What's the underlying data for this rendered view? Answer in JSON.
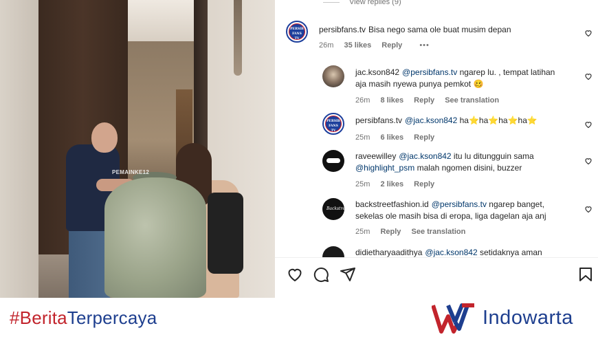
{
  "panel": {
    "view_replies": "View replies (9)"
  },
  "comments": [
    {
      "username": "persibfans.tv",
      "text": "Bisa nego sama ole buat musim depan",
      "time": "26m",
      "likes": "35 likes",
      "reply": "Reply",
      "more": "•••",
      "avatar": "persib-fans-tv-badge",
      "avatar_text": "PERSIB FANS TV"
    },
    {
      "username": "jac.kson842",
      "mention": "@persibfans.tv",
      "text_line1": " ngarep lu. , tempat latihan",
      "text_line2": "aja masih nyewa punya pemkot",
      "emoji": "🥴",
      "time": "26m",
      "likes": "8 likes",
      "reply": "Reply",
      "translation": "See translation"
    },
    {
      "username": "persibfans.tv",
      "mention": "@jac.kson842",
      "text": " ha",
      "star": "⭐",
      "ha": "ha",
      "time": "25m",
      "likes": "6 likes",
      "reply": "Reply",
      "avatar_text": "PERSIB FANS TV"
    },
    {
      "username": "raveewilley",
      "mention": "@jac.kson842",
      "text_line1": " itu lu ditungguin sama",
      "mention2": "@highlight_psm",
      "text_line2": " malah ngomen disini, buzzer",
      "time": "25m",
      "likes": "2 likes",
      "reply": "Reply"
    },
    {
      "username": "backstreetfashion.id",
      "mention": "@persibfans.tv",
      "text_line1": " ngarep banget,",
      "text_line2": "sekelas ole masih bisa di eropa, liga dagelan aja anj",
      "time": "25m",
      "reply": "Reply",
      "translation": "See translation",
      "avatar_text": "Backstreet"
    },
    {
      "username": "didietharyaadithya",
      "mention": "@jac.kson842",
      "text": " setidaknya aman"
    }
  ],
  "actions": {
    "like_icon": "heart-icon",
    "comment_icon": "comment-icon",
    "share_icon": "send-icon",
    "save_icon": "bookmark-icon"
  },
  "photo": {
    "watermark": "PEMAINKE12"
  },
  "banner": {
    "hashtag_part1": "#Berita",
    "hashtag_part2": "Terpercaya",
    "brand": "Indowarta",
    "colors": {
      "red": "#c2242c",
      "blue": "#1e3f8f"
    }
  }
}
